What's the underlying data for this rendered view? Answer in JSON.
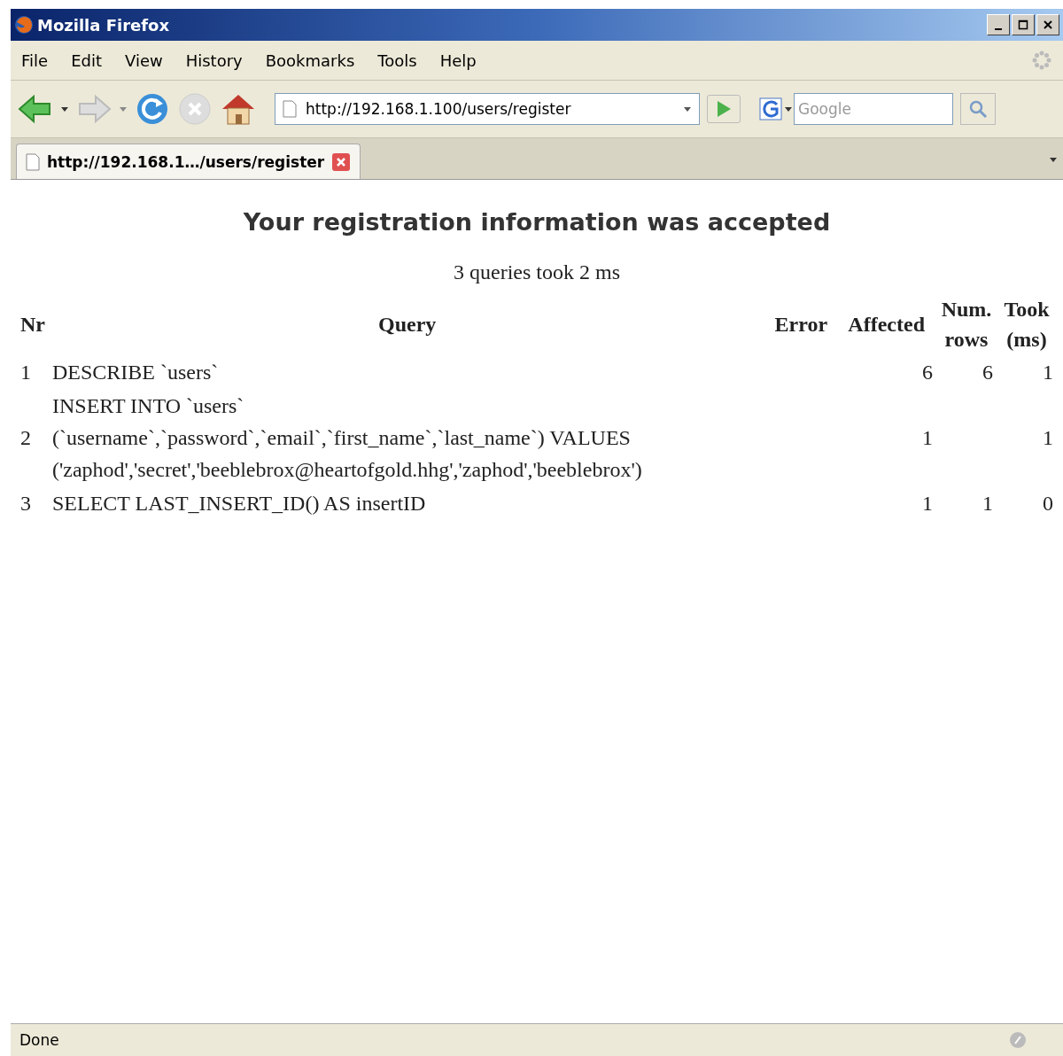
{
  "window": {
    "title": "Mozilla Firefox"
  },
  "menu": [
    "File",
    "Edit",
    "View",
    "History",
    "Bookmarks",
    "Tools",
    "Help"
  ],
  "address_bar": {
    "value": "http://192.168.1.100/users/register"
  },
  "search": {
    "placeholder": "Google"
  },
  "tabs": [
    {
      "label": "http://192.168.1…/users/register",
      "selected": true
    }
  ],
  "page": {
    "heading": "Your registration information was accepted",
    "summary": "3 queries took 2 ms"
  },
  "table": {
    "columns": [
      "Nr",
      "Query",
      "Error",
      "Affected",
      "Num. rows",
      "Took (ms)"
    ],
    "rows": [
      {
        "nr": "1",
        "query": "DESCRIBE `users`",
        "error": "",
        "affected": "6",
        "num_rows": "6",
        "took": "1"
      },
      {
        "nr": "2",
        "query": "INSERT INTO `users`\n(`username`,`password`,`email`,`first_name`,`last_name`) VALUES\n('zaphod','secret','beeblebrox@heartofgold.hhg','zaphod','beeblebrox')",
        "error": "",
        "affected": "1",
        "num_rows": "",
        "took": "1"
      },
      {
        "nr": "3",
        "query": "SELECT LAST_INSERT_ID() AS insertID",
        "error": "",
        "affected": "1",
        "num_rows": "1",
        "took": "0"
      }
    ]
  },
  "status_bar": {
    "text": "Done"
  }
}
